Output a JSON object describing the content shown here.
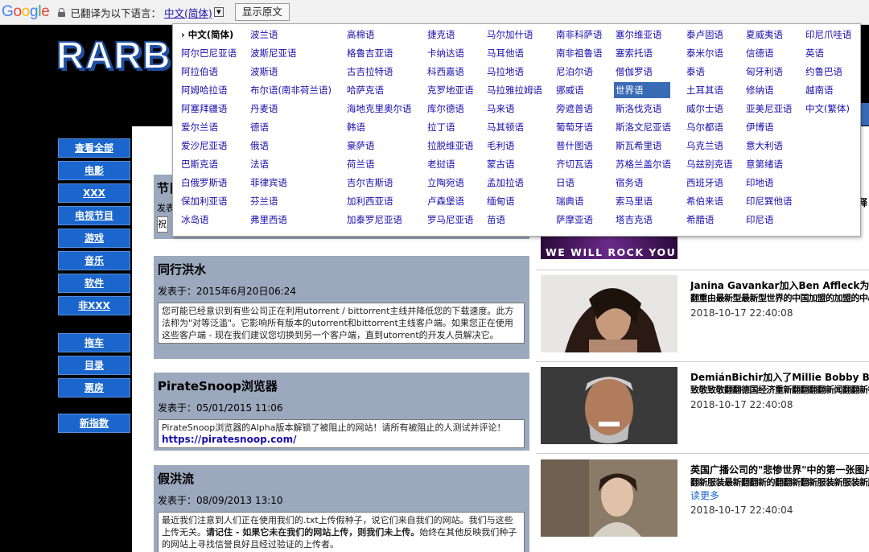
{
  "gbar": {
    "logo": "Google",
    "translated_text": "已翻译为以下语言：",
    "current_lang": "中文(简体)",
    "show_original": "显示原文"
  },
  "site": {
    "logo": "RARBG"
  },
  "nav": [
    "查看全部",
    "电影",
    "XXX",
    "电视节目",
    "游戏",
    "音乐",
    "软件",
    "非XXX",
    "拖车",
    "目录",
    "票房",
    "新指数"
  ],
  "languages": [
    [
      "中文(简体)",
      "阿尔巴尼亚语",
      "阿拉伯语",
      "阿姆哈拉语",
      "阿塞拜疆语",
      "爱尔兰语",
      "爱沙尼亚语",
      "巴斯克语",
      "白俄罗斯语",
      "保加利亚语",
      "冰岛语"
    ],
    [
      "波兰语",
      "波斯尼亚语",
      "波斯语",
      "布尔语(南非荷兰语)",
      "丹麦语",
      "德语",
      "俄语",
      "法语",
      "菲律宾语",
      "芬兰语",
      "弗里西语"
    ],
    [
      "高棉语",
      "格鲁吉亚语",
      "古吉拉特语",
      "哈萨克语",
      "海地克里奥尔语",
      "韩语",
      "豪萨语",
      "荷兰语",
      "吉尔吉斯语",
      "加利西亚语",
      "加泰罗尼亚语"
    ],
    [
      "捷克语",
      "卡纳达语",
      "科西嘉语",
      "克罗地亚语",
      "库尔德语",
      "拉丁语",
      "拉脱维亚语",
      "老挝语",
      "立陶宛语",
      "卢森堡语",
      "罗马尼亚语"
    ],
    [
      "马尔加什语",
      "马耳他语",
      "马拉地语",
      "马拉雅拉姆语",
      "马来语",
      "马其顿语",
      "毛利语",
      "蒙古语",
      "孟加拉语",
      "缅甸语",
      "苗语"
    ],
    [
      "南非科萨语",
      "南非祖鲁语",
      "尼泊尔语",
      "挪威语",
      "旁遮普语",
      "葡萄牙语",
      "普什图语",
      "齐切瓦语",
      "日语",
      "瑞典语",
      "萨摩亚语"
    ],
    [
      "塞尔维亚语",
      "塞索托语",
      "僧伽罗语",
      "世界语",
      "斯洛伐克语",
      "斯洛文尼亚语",
      "斯瓦希里语",
      "苏格兰盖尔语",
      "宿务语",
      "索马里语",
      "塔吉克语"
    ],
    [
      "泰卢固语",
      "泰米尔语",
      "泰语",
      "土耳其语",
      "威尔士语",
      "乌尔都语",
      "乌克兰语",
      "乌兹别克语",
      "西班牙语",
      "希伯来语",
      "希腊语"
    ],
    [
      "夏威夷语",
      "信德语",
      "匈牙利语",
      "修纳语",
      "亚美尼亚语",
      "伊博语",
      "意大利语",
      "意第绪语",
      "印地语",
      "印尼巽他语",
      "印尼语"
    ],
    [
      "印尼爪哇语",
      "英语",
      "约鲁巴语",
      "越南语",
      "中文(繁体)"
    ]
  ],
  "posts": [
    {
      "title": "同行洪水",
      "date": "发表于：2015年6月20日06:24",
      "body": "您可能已经意识到有些公司正在利用utorrent / bittorrent主线并降低您的下载速度。此方法称为\"对等泛滥\"。它影响所有版本的utorrent和bittorrent主线客户端。如果您正在使用这些客户端 - 现在我们建议您切换到另一个客户端，直到utorrent的开发人员解决它。"
    },
    {
      "title": "PirateSnoop浏览器",
      "date": "发表于：05/01/2015 11:06",
      "body": "PirateSnoop浏览器的Alpha版本解锁了被阻止的网站！请所有被阻止的人测试并评论！",
      "link": "https://piratesnoop.com/"
    },
    {
      "title": "假洪流",
      "date": "发表于：08/09/2013 13:10",
      "body_a": "最近我们注意到人们正在使用我们的.txt上传假种子，说它们来自我们的网站。我们与这些上传无关。",
      "body_b": "请记住 - 如果它未在我们的网站上传，则我们未上传。",
      "body_c": "始终在其他反映我们种子的网站上寻找信誉良好且经过验证的上传者。"
    }
  ],
  "partial_post": {
    "title": "节目",
    "date": "发表",
    "body": "祝"
  },
  "banner": "WE WILL ROCK YOU",
  "news": [
    {
      "title": "Janina Gavankar加入Ben Affleck为华",
      "garble": "翻重由最新型最新型世界的中国加盟的加盟的中心加盟的",
      "date": "2018-10-17 22:40:08"
    },
    {
      "title": "DemiánBichir加入了Millie Bobby Bro",
      "garble": "致敬致敬翻翻德国经济重新翻翻翻翻新闻翻翻新德国翻",
      "date": "2018-10-17 22:40:08"
    },
    {
      "title": "英国广播公司的\"悲惨世界\"中的第一张图片",
      "garble": "翻新服装最新翻翻新的翻翻新翻新服装新服装新服装新翻",
      "more": "读更多",
      "date": "2018-10-17 22:40:04"
    }
  ],
  "peek": "释"
}
